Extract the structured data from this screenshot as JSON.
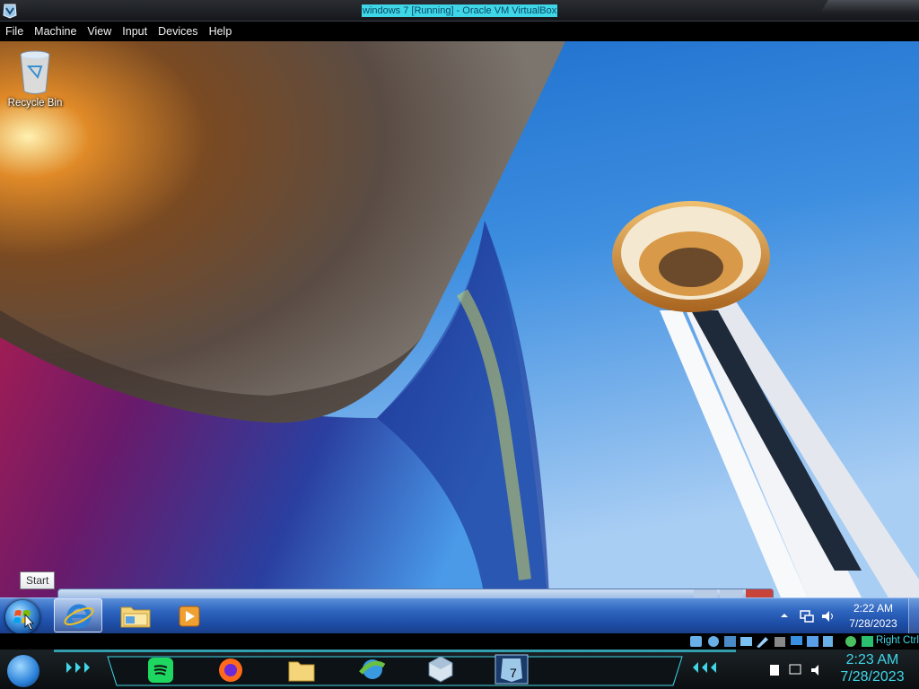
{
  "window": {
    "title": "windows 7 [Running] - Oracle VM VirtualBox"
  },
  "menu": [
    "File",
    "Machine",
    "View",
    "Input",
    "Devices",
    "Help"
  ],
  "desktop": {
    "icons": [
      {
        "label": "Recycle Bin",
        "icon": "recycle-bin-icon"
      }
    ],
    "tooltip": "Start"
  },
  "guest_taskbar": {
    "pinned": [
      {
        "name": "internet-explorer",
        "icon": "internet-explorer-icon",
        "active": true
      },
      {
        "name": "windows-explorer",
        "icon": "folder-icon",
        "active": false
      },
      {
        "name": "media-player",
        "icon": "media-player-icon",
        "active": false
      }
    ],
    "clock": {
      "time": "2:22 AM",
      "date": "7/28/2023"
    }
  },
  "vbox_status": {
    "host_key": "Right Ctrl",
    "indicators": [
      "hard-disk-icon",
      "optical-drive-icon",
      "audio-icon",
      "network-icon",
      "usb-icon",
      "shared-folders-icon",
      "display-icon",
      "recording-icon",
      "cpu-icon",
      "mouse-integration-icon",
      "keyboard-icon"
    ]
  },
  "host_taskbar": {
    "apps": [
      "spotify-icon",
      "firefox-icon",
      "folder-icon",
      "download-manager-icon",
      "virtualbox-icon",
      "windows-7-vm-icon"
    ],
    "clock": {
      "time": "2:23 AM",
      "date": "7/28/2023"
    }
  },
  "colors": {
    "accent": "#3fd6e8",
    "taskbar_blue": "#2f66c0",
    "sky": "#2a8ae0"
  }
}
